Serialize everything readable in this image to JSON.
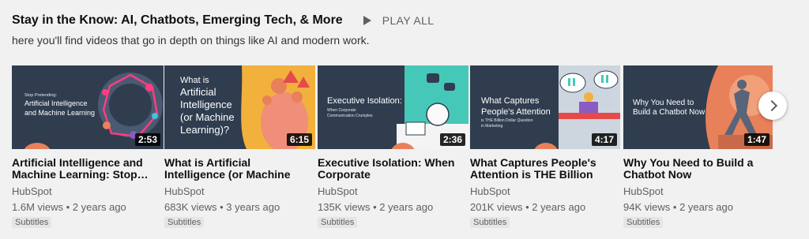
{
  "shelf": {
    "title": "Stay in the Know: AI, Chatbots, Emerging Tech, & More",
    "play_all_label": "PLAY ALL",
    "description": "here you'll find videos that go in depth on things like AI and modern work."
  },
  "videos": [
    {
      "title": "Artificial Intelligence and Machine Learning: Stop…",
      "channel": "HubSpot",
      "views": "1.6M views",
      "age": "2 years ago",
      "badge": "Subtitles",
      "duration": "2:53",
      "thumb_text": [
        "Stop Pretending:",
        "Artificial Intelligence",
        "and Machine Learning"
      ]
    },
    {
      "title": "What is Artificial Intelligence (or Machine Learning)?",
      "channel": "HubSpot",
      "views": "683K views",
      "age": "3 years ago",
      "badge": "Subtitles",
      "duration": "6:15",
      "thumb_text": [
        "What is",
        "Artificial",
        "Intelligence",
        "(or Machine",
        "Learning)?"
      ]
    },
    {
      "title": "Executive Isolation: When Corporate Communication…",
      "channel": "HubSpot",
      "views": "135K views",
      "age": "2 years ago",
      "badge": "Subtitles",
      "duration": "2:36",
      "thumb_text": [
        "Executive Isolation:",
        "When Corporate",
        "Communication Crumples"
      ]
    },
    {
      "title": "What Captures People's Attention is THE Billion Doll…",
      "channel": "HubSpot",
      "views": "201K views",
      "age": "2 years ago",
      "badge": "Subtitles",
      "duration": "4:17",
      "thumb_text": [
        "What Captures",
        "People's Attention",
        "is THE Billion Dollar Question",
        "in Marketing"
      ]
    },
    {
      "title": "Why You Need to Build a Chatbot Now",
      "channel": "HubSpot",
      "views": "94K views",
      "age": "2 years ago",
      "badge": "Subtitles",
      "duration": "1:47",
      "thumb_text": [
        "Why You Need to",
        "Build a Chatbot Now"
      ]
    }
  ],
  "meta_separator": "•",
  "icons": {
    "play": "play-icon",
    "next": "chevron-right-icon"
  },
  "colors": {
    "thumb_navy": "#2f3d4f",
    "accent_orange": "#e8805a"
  }
}
